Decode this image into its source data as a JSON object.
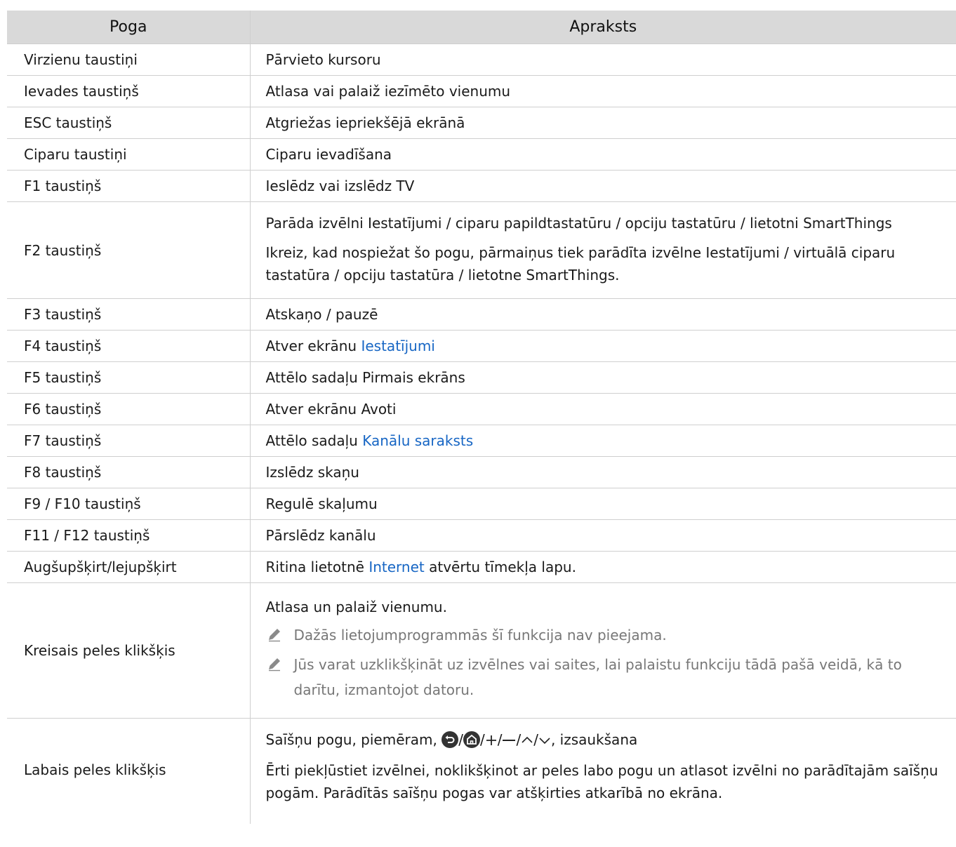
{
  "table": {
    "headers": [
      "Poga",
      "Apraksts"
    ],
    "rows": [
      {
        "key": "Virzienu taustiņi",
        "desc": "Pārvieto kursoru"
      },
      {
        "key": "Ievades taustiņš",
        "desc": "Atlasa vai palaiž iezīmēto vienumu"
      },
      {
        "key": "ESC taustiņš",
        "desc": "Atgriežas iepriekšējā ekrānā"
      },
      {
        "key": "Ciparu taustiņi",
        "desc": "Ciparu ievadīšana"
      },
      {
        "key": "F1 taustiņš",
        "desc": "Ieslēdz vai izslēdz TV"
      },
      {
        "key": "F2 taustiņš",
        "desc": "Parāda izvēlni Iestatījumi / ciparu papildtastatūru / opciju tastatūru / lietotni SmartThings",
        "desc2": "Ikreiz, kad nospiežat šo pogu, pārmaiņus tiek parādīta izvēlne Iestatījumi / virtuālā ciparu tastatūra / opciju tastatūra / lietotne SmartThings."
      },
      {
        "key": "F3 taustiņš",
        "desc": "Atskaņo / pauzē"
      },
      {
        "key": "F4 taustiņš",
        "desc_pre": "Atver ekrānu ",
        "desc_link": "Iestatījumi"
      },
      {
        "key": "F5 taustiņš",
        "desc": "Attēlo sadaļu Pirmais ekrāns"
      },
      {
        "key": "F6 taustiņš",
        "desc": "Atver ekrānu Avoti"
      },
      {
        "key": "F7 taustiņš",
        "desc_pre": "Attēlo sadaļu ",
        "desc_link": "Kanālu saraksts"
      },
      {
        "key": "F8 taustiņš",
        "desc": "Izslēdz skaņu"
      },
      {
        "key": "F9 / F10 taustiņš",
        "desc": "Regulē skaļumu"
      },
      {
        "key": "F11 / F12 taustiņš",
        "desc": "Pārslēdz kanālu"
      },
      {
        "key": "Augšupšķirt/lejupšķirt",
        "desc_pre": "Ritina lietotnē ",
        "desc_link": "Internet",
        "desc_post": " atvērtu tīmekļa lapu."
      },
      {
        "key": "Kreisais peles klikšķis",
        "desc": "Atlasa un palaiž vienumu.",
        "notes": [
          "Dažās lietojumprogrammās šī funkcija nav pieejama.",
          "Jūs varat uzklikšķināt uz izvēlnes vai saites, lai palaistu funkciju tādā pašā veidā, kā to darītu, izmantojot datoru."
        ]
      },
      {
        "key": "Labais peles klikšķis",
        "desc_pre": "Saīšņu pogu, piemēram, ",
        "desc_post": ", izsaukšana",
        "desc2": "Ērti piekļūstiet izvēlnei, noklikšķinot ar peles labo pogu un atlasot izvēlni no parādītajām saīšņu pogām. Parādītās saīšņu pogas var atšķirties atkarībā no ekrāna."
      }
    ]
  },
  "icons": [
    "return-icon",
    "home-icon",
    "plus-icon",
    "minus-icon",
    "up-chevron-icon",
    "down-chevron-icon",
    "pencil-note-icon"
  ],
  "colors": {
    "header_bg": "#d9d9d9",
    "link": "#1766c4",
    "note_text": "#777777"
  }
}
